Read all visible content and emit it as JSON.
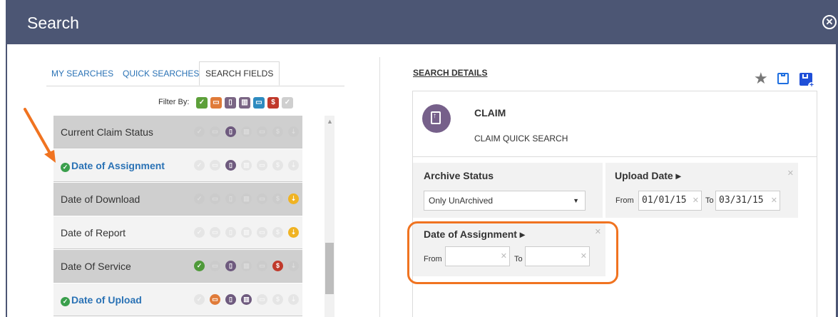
{
  "dialog": {
    "title": "Search"
  },
  "tabs": [
    {
      "label": "MY SEARCHES"
    },
    {
      "label": "QUICK SEARCHES"
    },
    {
      "label": "SEARCH FIELDS"
    }
  ],
  "filter": {
    "label": "Filter By:",
    "chips": [
      {
        "icon": "check-icon",
        "glyph": "✓",
        "color": "#5da03a"
      },
      {
        "icon": "download-icon",
        "glyph": "▭",
        "color": "#e07b39"
      },
      {
        "icon": "document-icon",
        "glyph": "▯",
        "color": "#7a6584"
      },
      {
        "icon": "report-icon",
        "glyph": "▥",
        "color": "#7a6584"
      },
      {
        "icon": "service-icon",
        "glyph": "▭",
        "color": "#2e8bc0"
      },
      {
        "icon": "dollar-icon",
        "glyph": "$",
        "color": "#c0392b"
      },
      {
        "icon": "check-faint-icon",
        "glyph": "✓",
        "color": "#cfcfcf"
      }
    ]
  },
  "fields": [
    {
      "label": "Current Claim Status",
      "selected": false,
      "active_icons": [
        2
      ]
    },
    {
      "label": "Date of Assignment",
      "selected": true,
      "active_icons": [
        2
      ]
    },
    {
      "label": "Date of Download",
      "selected": false,
      "active_icons": [
        6
      ]
    },
    {
      "label": "Date of Report",
      "selected": false,
      "active_icons": [
        6
      ]
    },
    {
      "label": "Date Of Service",
      "selected": false,
      "active_icons": [
        0,
        2,
        5
      ]
    },
    {
      "label": "Date of Upload",
      "selected": true,
      "active_icons": [
        1,
        2,
        3
      ]
    }
  ],
  "icon_set": [
    {
      "name": "check-icon",
      "glyph": "✓",
      "color": "#4f9a3a"
    },
    {
      "name": "download-icon",
      "glyph": "▭",
      "color": "#e07b39"
    },
    {
      "name": "document-icon",
      "glyph": "▯",
      "color": "#6e5a7e"
    },
    {
      "name": "report-icon",
      "glyph": "▥",
      "color": "#6e5a7e"
    },
    {
      "name": "service-icon",
      "glyph": "▭",
      "color": "#2e8bc0"
    },
    {
      "name": "dollar-icon",
      "glyph": "$",
      "color": "#c0392b"
    },
    {
      "name": "upload-icon",
      "glyph": "⇣",
      "color": "#f0b323"
    }
  ],
  "details": {
    "header": "SEARCH DETAILS",
    "entity_title": "CLAIM",
    "entity_subtitle": "CLAIM QUICK SEARCH",
    "archive_status": {
      "label": "Archive Status",
      "value": "Only UnArchived"
    },
    "upload_date": {
      "label": "Upload Date ▸",
      "from_label": "From",
      "from": "01/01/15",
      "to_label": "To",
      "to": "03/31/15"
    },
    "assignment_date": {
      "label": "Date of Assignment ▸",
      "from_label": "From",
      "from": "",
      "to_label": "To",
      "to": ""
    }
  },
  "accent_colors": {
    "header_bar": "#4c5674",
    "highlight": "#f07320",
    "link": "#2a72b5"
  }
}
